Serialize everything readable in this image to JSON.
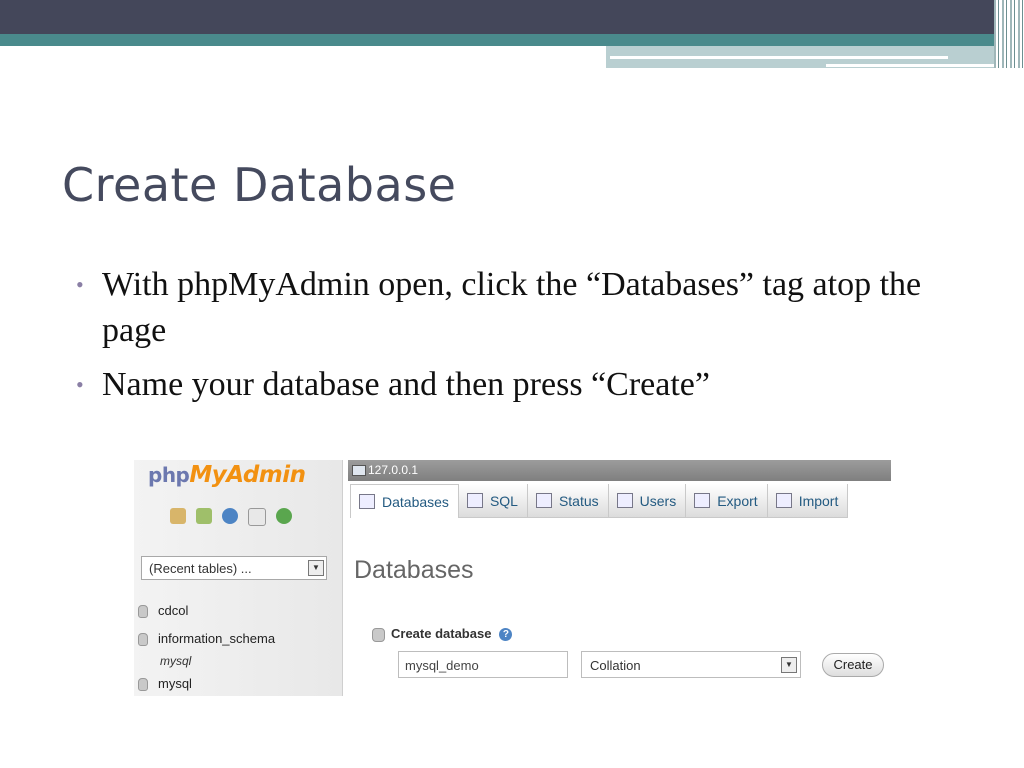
{
  "slide": {
    "title": "Create Database",
    "bullets": [
      "With phpMyAdmin open, click the “Databases” tag atop the page",
      "Name your database and then press “Create”"
    ]
  },
  "screenshot": {
    "logo": {
      "part1": "php",
      "part2": "MyAdmin"
    },
    "nav_icons": [
      "home-icon",
      "logout-icon",
      "help-icon",
      "docs-icon",
      "reload-icon"
    ],
    "recent_tables": "(Recent tables) ...",
    "databases": [
      {
        "name": "cdcol"
      },
      {
        "name": "information_schema",
        "sub": "mysql"
      },
      {
        "name": "mysql"
      }
    ],
    "server": "127.0.0.1",
    "tabs": [
      "Databases",
      "SQL",
      "Status",
      "Users",
      "Export",
      "Import"
    ],
    "heading": "Databases",
    "create_label": "Create database",
    "db_name_value": "mysql_demo",
    "collation": "Collation",
    "create_button": "Create",
    "colors": {
      "accent": "#235a81",
      "logo_orange": "#f29111",
      "logo_blue": "#6c78af"
    }
  }
}
